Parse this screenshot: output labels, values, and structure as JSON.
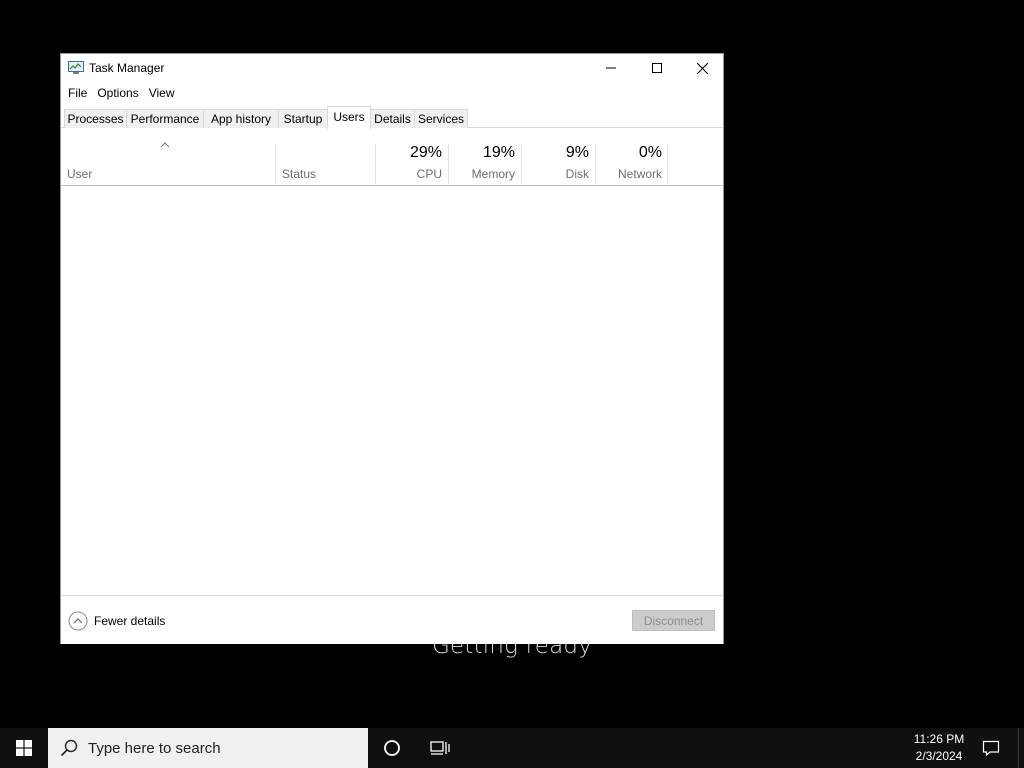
{
  "background": {
    "message": "Getting ready"
  },
  "window": {
    "title": "Task Manager",
    "menu": [
      "File",
      "Options",
      "View"
    ],
    "tabs": [
      "Processes",
      "Performance",
      "App history",
      "Startup",
      "Users",
      "Details",
      "Services"
    ],
    "active_tab": "Users",
    "columns": {
      "user": {
        "label": "User"
      },
      "status": {
        "label": "Status"
      },
      "cpu": {
        "label": "CPU",
        "pct": "29%"
      },
      "memory": {
        "label": "Memory",
        "pct": "19%"
      },
      "disk": {
        "label": "Disk",
        "pct": "9%"
      },
      "network": {
        "label": "Network",
        "pct": "0%"
      }
    },
    "footer": {
      "fewer_details": "Fewer details",
      "disconnect": "Disconnect"
    }
  },
  "taskbar": {
    "search_placeholder": "Type here to search",
    "time": "11:26 PM",
    "date": "2/3/2024"
  }
}
